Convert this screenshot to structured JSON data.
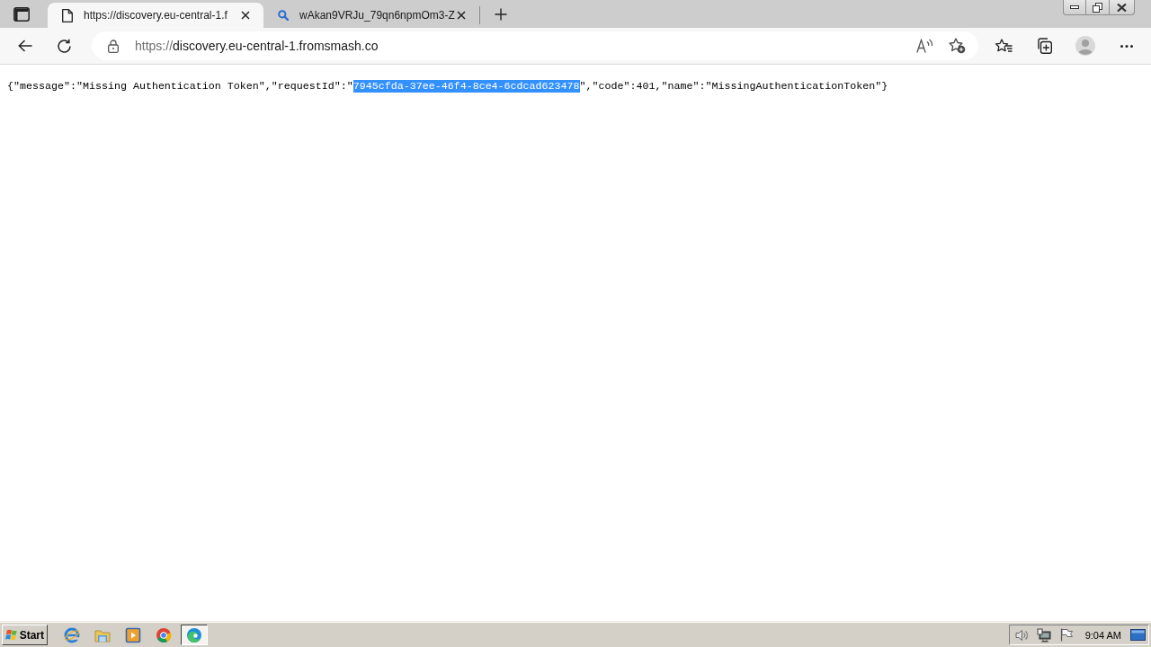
{
  "tab_strip": {
    "tabs": [
      {
        "kind": "page",
        "title": "https://discovery.eu-central-1.f",
        "selected": true
      },
      {
        "kind": "search",
        "title": "wAkan9VRJu_79qn6npmOm3-Z",
        "selected": false
      }
    ]
  },
  "toolbar": {
    "address": {
      "scheme": "https://",
      "host": "discovery.eu-central-1.fromsmash.co"
    }
  },
  "page": {
    "segments": [
      {
        "text": "{\"message\":\"Missing Authentication Token\",\"requestId\":\"",
        "selected": false
      },
      {
        "text": "7945cfda-37ee-46f4-8ce4-6cdcad623478",
        "selected": true
      },
      {
        "text": "\",\"code\":401,\"name\":\"MissingAuthenticationToken\"}",
        "selected": false
      }
    ]
  },
  "taskbar": {
    "start": "Start",
    "apps": [
      {
        "kind": "e",
        "selected": false
      },
      {
        "kind": "folder",
        "selected": false
      },
      {
        "kind": "play",
        "selected": false
      },
      {
        "kind": "ring",
        "selected": false
      },
      {
        "kind": "wave",
        "selected": true
      }
    ],
    "clock": "9:04 AM"
  }
}
